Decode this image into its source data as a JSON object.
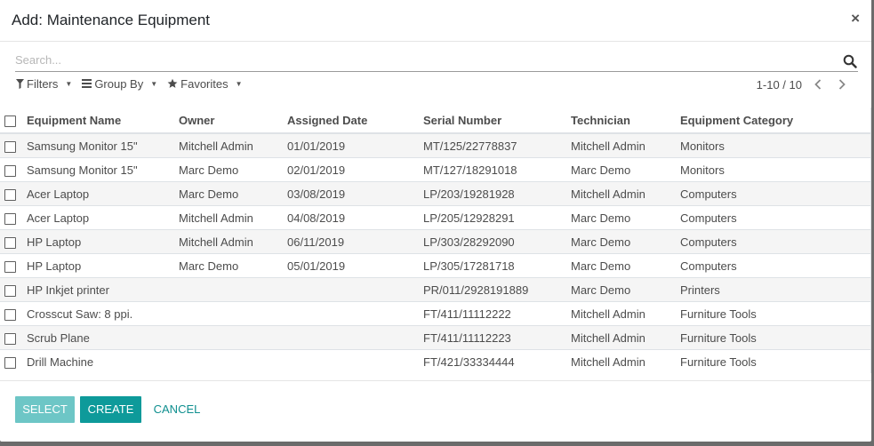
{
  "dialog": {
    "title": "Add: Maintenance Equipment",
    "close_label": "×"
  },
  "search": {
    "placeholder": "Search...",
    "value": ""
  },
  "filters": {
    "filters_label": "Filters",
    "group_by_label": "Group By",
    "favorites_label": "Favorites"
  },
  "pager": {
    "text": "1-10 / 10"
  },
  "table": {
    "headers": {
      "name": "Equipment Name",
      "owner": "Owner",
      "date": "Assigned Date",
      "serial": "Serial Number",
      "technician": "Technician",
      "category": "Equipment Category"
    },
    "rows": [
      {
        "name": "Samsung Monitor 15\"",
        "owner": "Mitchell Admin",
        "date": "01/01/2019",
        "serial": "MT/125/22778837",
        "technician": "Mitchell Admin",
        "category": "Monitors"
      },
      {
        "name": "Samsung Monitor 15\"",
        "owner": "Marc Demo",
        "date": "02/01/2019",
        "serial": "MT/127/18291018",
        "technician": "Marc Demo",
        "category": "Monitors"
      },
      {
        "name": "Acer Laptop",
        "owner": "Marc Demo",
        "date": "03/08/2019",
        "serial": "LP/203/19281928",
        "technician": "Mitchell Admin",
        "category": "Computers"
      },
      {
        "name": "Acer Laptop",
        "owner": "Mitchell Admin",
        "date": "04/08/2019",
        "serial": "LP/205/12928291",
        "technician": "Marc Demo",
        "category": "Computers"
      },
      {
        "name": "HP Laptop",
        "owner": "Mitchell Admin",
        "date": "06/11/2019",
        "serial": "LP/303/28292090",
        "technician": "Marc Demo",
        "category": "Computers"
      },
      {
        "name": "HP Laptop",
        "owner": "Marc Demo",
        "date": "05/01/2019",
        "serial": "LP/305/17281718",
        "technician": "Marc Demo",
        "category": "Computers"
      },
      {
        "name": "HP Inkjet printer",
        "owner": "",
        "date": "",
        "serial": "PR/011/2928191889",
        "technician": "Marc Demo",
        "category": "Printers"
      },
      {
        "name": "Crosscut Saw: 8 ppi.",
        "owner": "",
        "date": "",
        "serial": "FT/411/11112222",
        "technician": "Mitchell Admin",
        "category": "Furniture Tools"
      },
      {
        "name": "Scrub Plane",
        "owner": "",
        "date": "",
        "serial": "FT/411/11112223",
        "technician": "Mitchell Admin",
        "category": "Furniture Tools"
      },
      {
        "name": "Drill Machine",
        "owner": "",
        "date": "",
        "serial": "FT/421/33334444",
        "technician": "Mitchell Admin",
        "category": "Furniture Tools"
      }
    ]
  },
  "footer": {
    "select_label": "SELECT",
    "create_label": "CREATE",
    "cancel_label": "CANCEL"
  },
  "colors": {
    "primary": "#00a09d",
    "primary_disabled": "#66c4c4"
  },
  "icons": {
    "search": "search-icon",
    "filter": "filter-icon",
    "group_by": "list-icon",
    "favorites": "star-icon",
    "prev": "chevron-left-icon",
    "next": "chevron-right-icon",
    "close": "close-icon"
  }
}
